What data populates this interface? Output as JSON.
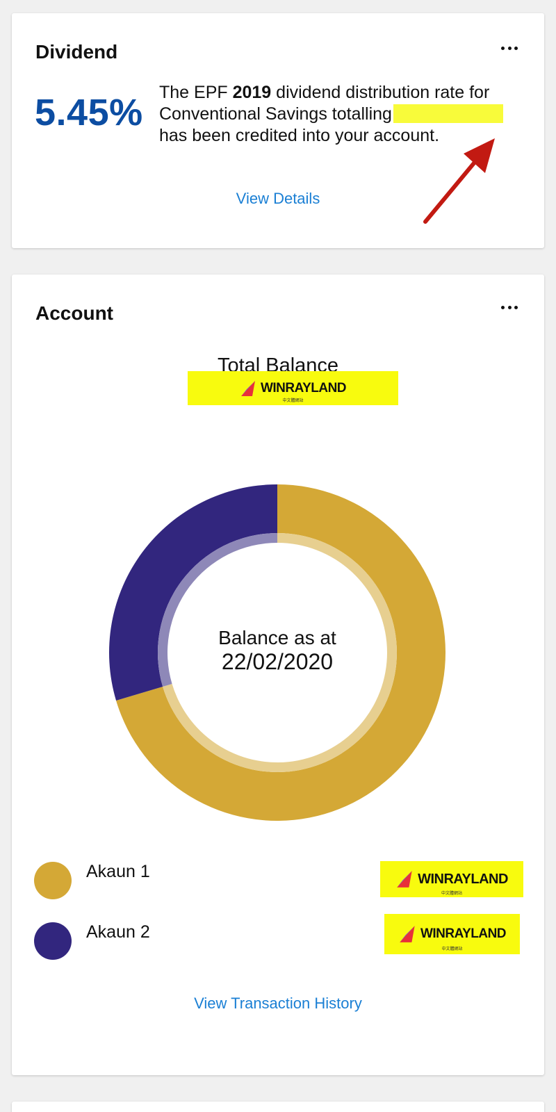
{
  "dividend": {
    "title": "Dividend",
    "rate": "5.45%",
    "text_before": "The EPF ",
    "year": "2019",
    "text_after": " dividend distribution rate for Conventional Savings totalling",
    "text_end": " has been credited into your account.",
    "link": "View Details"
  },
  "account": {
    "title": "Account",
    "total_label": "Total Balance",
    "logo_word": "WINRAYLAND",
    "logo_sub": "中文體網站",
    "center_line1": "Balance as at",
    "center_line2": "22/02/2020",
    "legend": [
      {
        "label": "Akaun 1",
        "color": "#d4a836"
      },
      {
        "label": "Akaun 2",
        "color": "#32267e"
      }
    ],
    "link": "View Transaction History"
  },
  "chart_data": {
    "type": "pie",
    "labels": [
      "Akaun 1",
      "Akaun 2"
    ],
    "values": [
      70.4,
      29.6
    ],
    "colors": [
      "#d4a836",
      "#32267e"
    ],
    "donut": true
  },
  "colors": {
    "accent_blue": "#0c4da2",
    "link_blue": "#1a7fd4",
    "highlight_yellow": "#f8fb0e",
    "arrow_red": "#c21a12"
  }
}
